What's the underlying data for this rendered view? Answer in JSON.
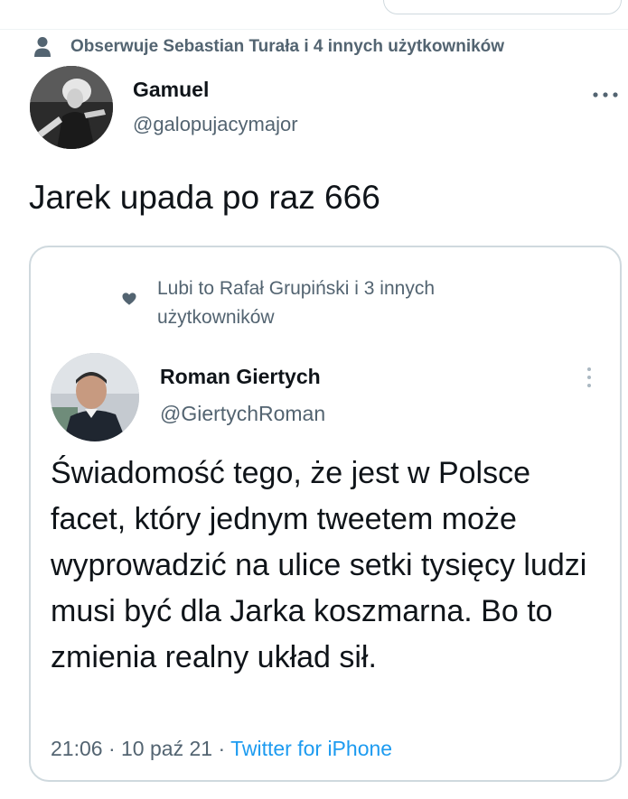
{
  "social_context": {
    "text": "Obserwuje Sebastian Turała i 4 innych użytkowników",
    "icon": "person-icon"
  },
  "author": {
    "name": "Gamuel",
    "handle": "@galopujacymajor",
    "more_icon": "more-horizontal-icon"
  },
  "tweet": {
    "text": "Jarek upada po raz 666"
  },
  "quoted_tweet": {
    "liked_by": "Lubi to Rafał Grupiński i 3 innych użytkowników",
    "liked_icon": "heart-icon",
    "name": "Roman Giertych",
    "handle": "@GiertychRoman",
    "more_icon": "more-vertical-icon",
    "text": "Świadomość tego, że jest w Polsce facet, który jednym tweetem może wyprowadzić na ulice setki tysięcy ludzi musi być dla Jarka koszmarna. Bo to zmienia realny układ sił.",
    "time": "21:06",
    "date": "10 paź 21",
    "separator": "·",
    "source": "Twitter for iPhone"
  },
  "colors": {
    "primary_text": "#0f1419",
    "secondary_text": "#536471",
    "link": "#1d9bf0",
    "border": "#cfd9de"
  }
}
